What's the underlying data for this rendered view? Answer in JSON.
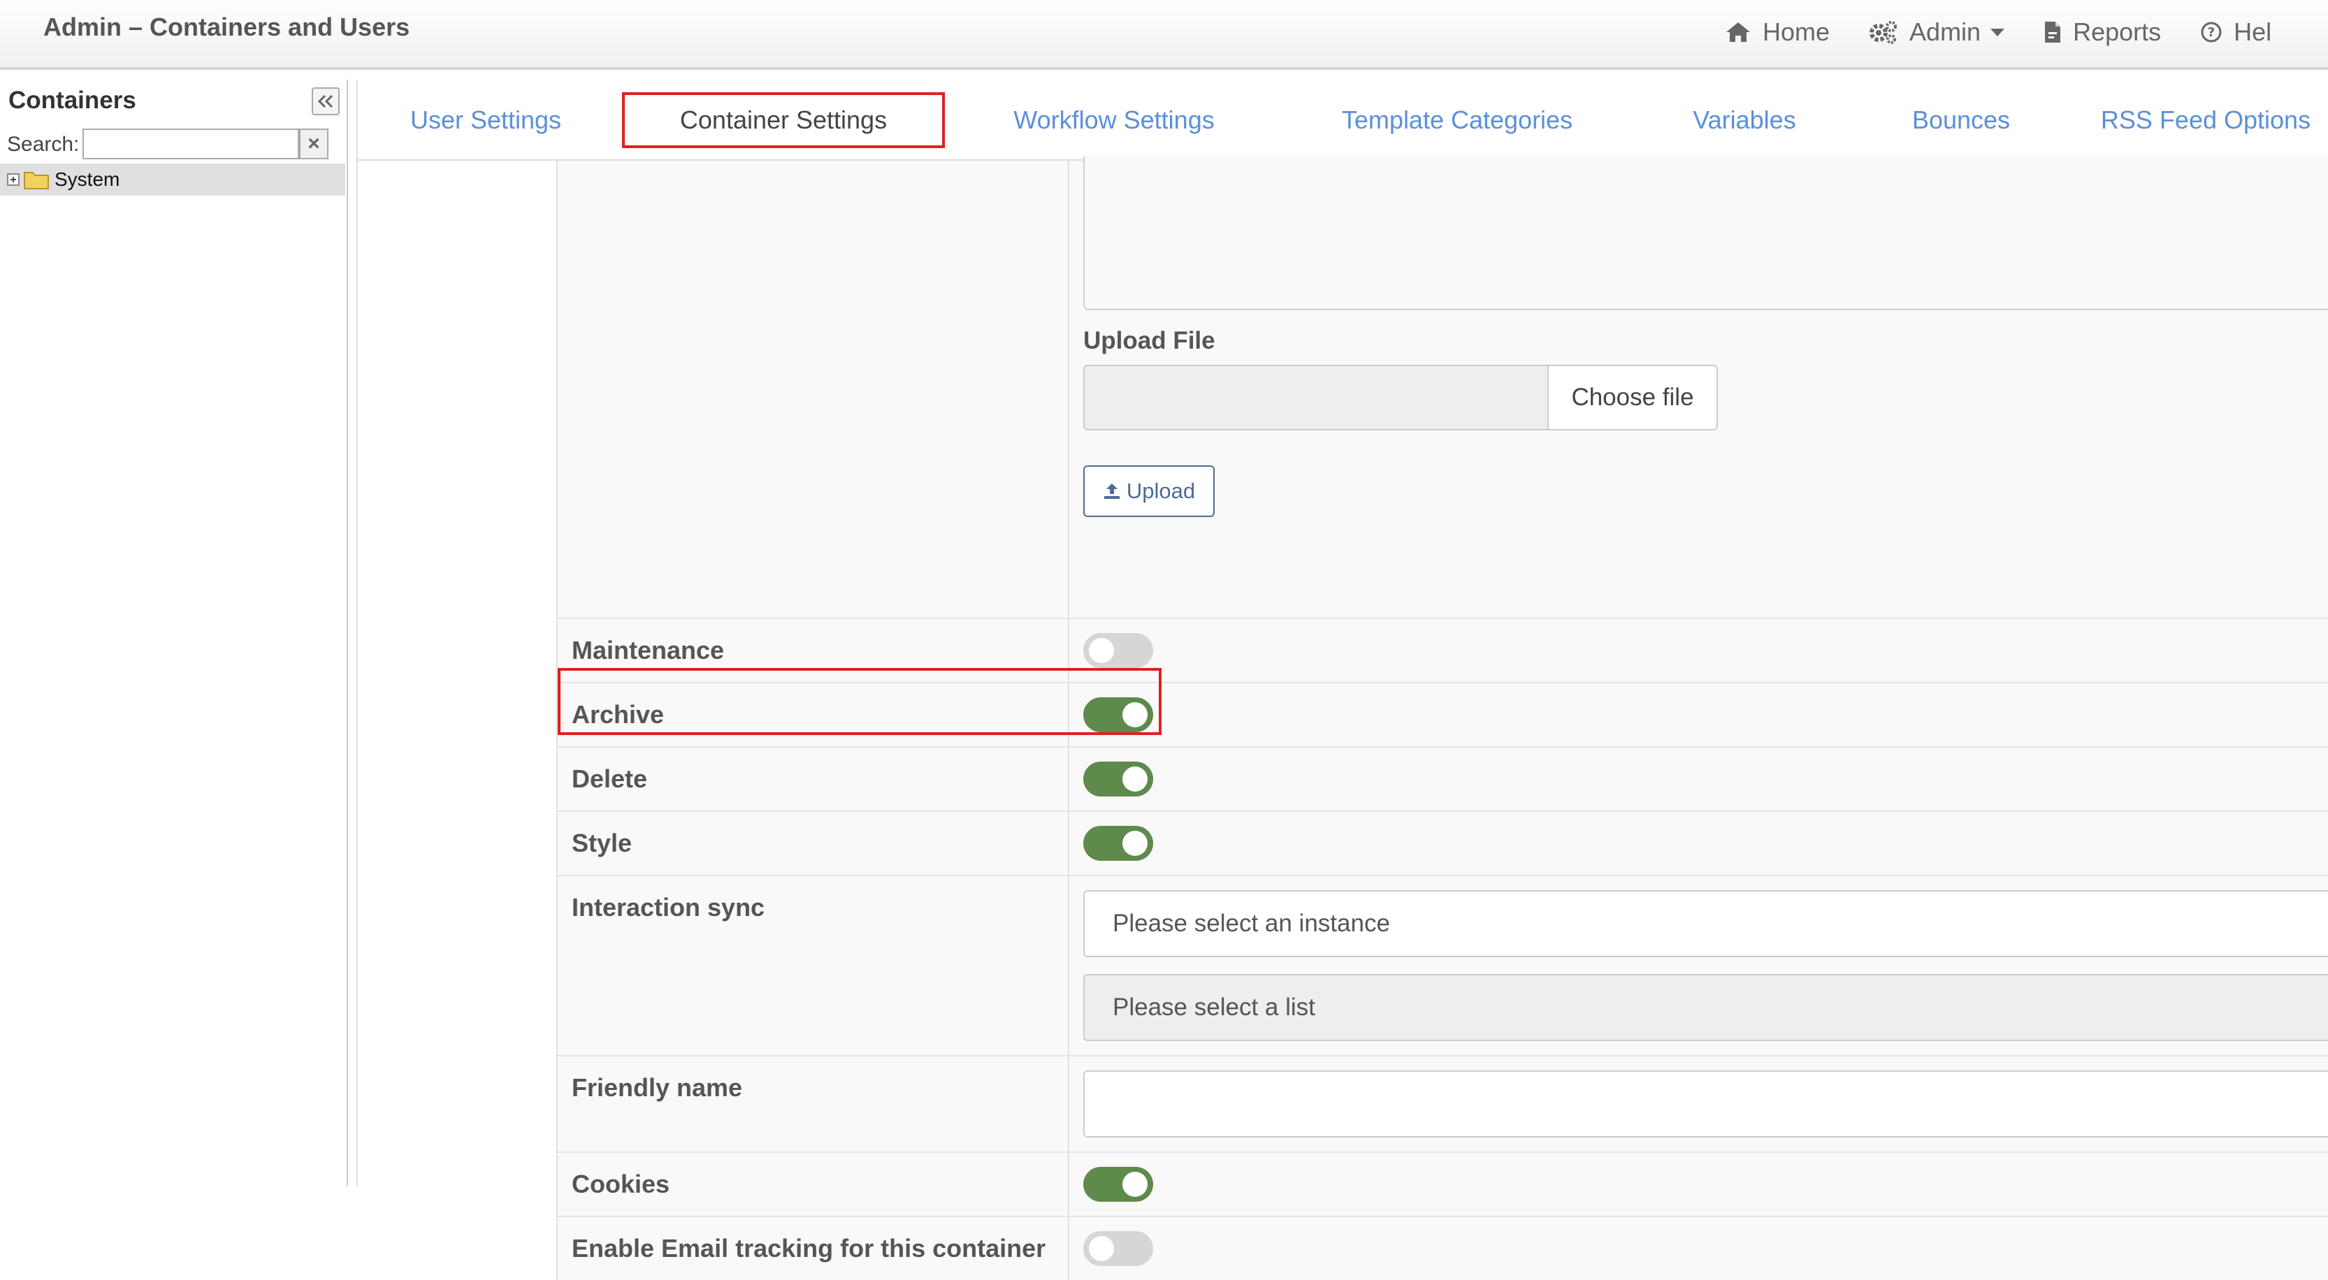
{
  "app": {
    "title": "Admin – Containers and Users"
  },
  "topnav": {
    "home": "Home",
    "admin": "Admin",
    "reports": "Reports",
    "help": "Hel"
  },
  "sidebar": {
    "title": "Containers",
    "search_label": "Search:",
    "search_value": "",
    "clear_label": "×",
    "tree": [
      {
        "label": "System",
        "expanded": false
      }
    ]
  },
  "tabs": [
    {
      "label": "User Settings",
      "active": false
    },
    {
      "label": "Container Settings",
      "active": true
    },
    {
      "label": "Workflow Settings",
      "active": false
    },
    {
      "label": "Template Categories",
      "active": false
    },
    {
      "label": "Variables",
      "active": false
    },
    {
      "label": "Bounces",
      "active": false
    },
    {
      "label": "RSS Feed Options",
      "active": false
    }
  ],
  "upload": {
    "label": "Upload File",
    "choose_label": "Choose file",
    "button_label": "Upload"
  },
  "settings": {
    "maintenance": {
      "label": "Maintenance",
      "on": false
    },
    "archive": {
      "label": "Archive",
      "on": true
    },
    "delete": {
      "label": "Delete",
      "on": true
    },
    "style": {
      "label": "Style",
      "on": true
    },
    "interaction_sync": {
      "label": "Interaction sync",
      "instance_placeholder": "Please select an instance",
      "list_placeholder": "Please select a list"
    },
    "friendly_name": {
      "label": "Friendly name",
      "value": ""
    },
    "cookies": {
      "label": "Cookies",
      "on": true
    },
    "email_tracking": {
      "label": "Enable Email tracking for this container",
      "on": false
    }
  },
  "colors": {
    "accent_link": "#5b8fd9",
    "toggle_on": "#5e8a4b",
    "toggle_off": "#d6d6d6",
    "highlight": "#e02020"
  }
}
